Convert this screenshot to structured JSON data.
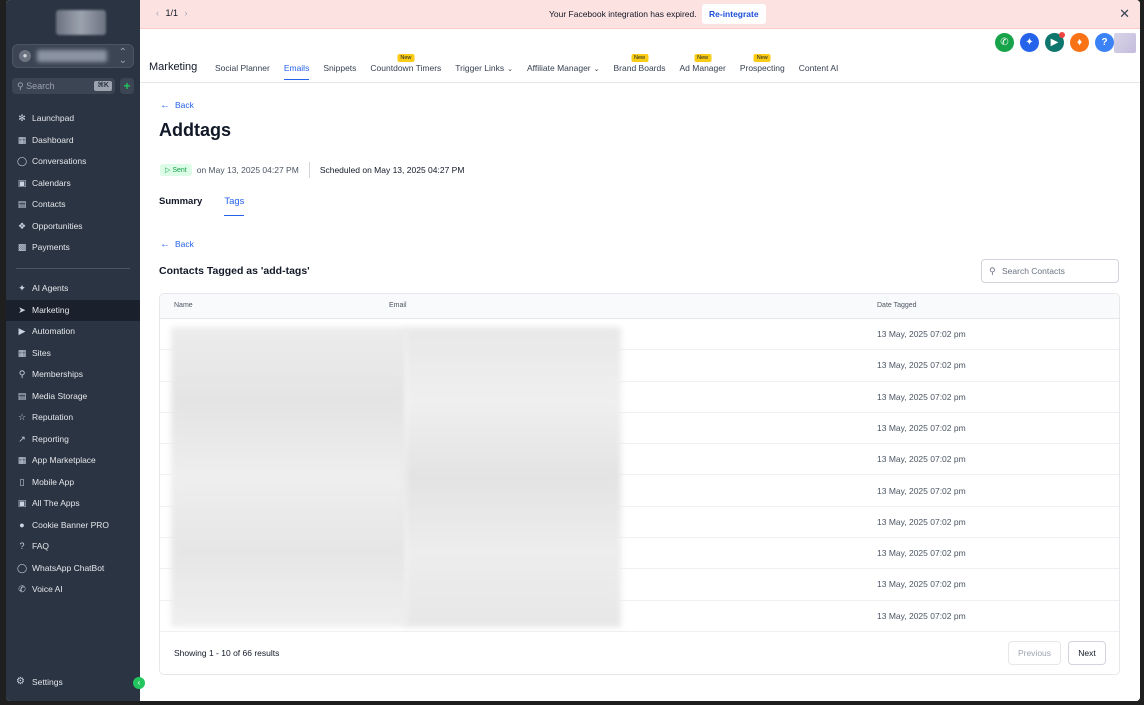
{
  "sidebar": {
    "search_placeholder": "Search",
    "search_shortcut": "⌘K",
    "primary": [
      {
        "label": "Launchpad",
        "icon": "rocket-icon"
      },
      {
        "label": "Dashboard",
        "icon": "grid-icon"
      },
      {
        "label": "Conversations",
        "icon": "chat-icon"
      },
      {
        "label": "Calendars",
        "icon": "calendar-icon"
      },
      {
        "label": "Contacts",
        "icon": "contacts-icon"
      },
      {
        "label": "Opportunities",
        "icon": "opportunities-icon"
      },
      {
        "label": "Payments",
        "icon": "payments-icon"
      }
    ],
    "secondary": [
      {
        "label": "AI Agents",
        "icon": "sparkle-icon"
      },
      {
        "label": "Marketing",
        "icon": "send-icon"
      },
      {
        "label": "Automation",
        "icon": "automation-icon"
      },
      {
        "label": "Sites",
        "icon": "sites-icon"
      },
      {
        "label": "Memberships",
        "icon": "badge-icon"
      },
      {
        "label": "Media Storage",
        "icon": "image-icon"
      },
      {
        "label": "Reputation",
        "icon": "star-icon"
      },
      {
        "label": "Reporting",
        "icon": "trend-icon"
      },
      {
        "label": "App Marketplace",
        "icon": "apps-icon"
      },
      {
        "label": "Mobile App",
        "icon": "mobile-icon"
      },
      {
        "label": "All The Apps",
        "icon": "all-apps-icon"
      },
      {
        "label": "Cookie Banner PRO",
        "icon": "cookie-icon"
      },
      {
        "label": "FAQ",
        "icon": "question-icon"
      },
      {
        "label": "WhatsApp ChatBot",
        "icon": "whatsapp-icon"
      },
      {
        "label": "Voice AI",
        "icon": "phone-icon"
      }
    ],
    "settings_label": "Settings"
  },
  "banner": {
    "pager": "1/1",
    "message": "Your Facebook integration has expired.",
    "action": "Re-integrate"
  },
  "header": {
    "section": "Marketing",
    "tabs": [
      {
        "label": "Social Planner",
        "new": false,
        "dropdown": false
      },
      {
        "label": "Emails",
        "new": false,
        "dropdown": false,
        "active": true
      },
      {
        "label": "Snippets",
        "new": false,
        "dropdown": false
      },
      {
        "label": "Countdown Timers",
        "new": true,
        "dropdown": false
      },
      {
        "label": "Trigger Links",
        "new": false,
        "dropdown": true
      },
      {
        "label": "Affiliate Manager",
        "new": false,
        "dropdown": true
      },
      {
        "label": "Brand Boards",
        "new": true,
        "dropdown": false
      },
      {
        "label": "Ad Manager",
        "new": true,
        "dropdown": false
      },
      {
        "label": "Prospecting",
        "new": true,
        "dropdown": false
      },
      {
        "label": "Content AI",
        "new": false,
        "dropdown": false
      }
    ],
    "new_badge": "New",
    "icon_colors": {
      "phone": "#16a34a",
      "magic": "#2563eb",
      "megaphone": "#0f766e",
      "bell": "#f97316",
      "help": "#3b82f6"
    }
  },
  "page": {
    "back_label": "Back",
    "title": "Addtags",
    "status": "Sent",
    "sent_date": "on May 13, 2025 04:27 PM",
    "scheduled": "Scheduled on May 13, 2025 04:27 PM",
    "sub_tabs": [
      "Summary",
      "Tags"
    ],
    "section_title": "Contacts Tagged as 'add-tags'",
    "search_placeholder": "Search Contacts"
  },
  "table": {
    "columns": [
      "Name",
      "Email",
      "Date Tagged"
    ],
    "rows": [
      "13 May, 2025 07:02 pm",
      "13 May, 2025 07:02 pm",
      "13 May, 2025 07:02 pm",
      "13 May, 2025 07:02 pm",
      "13 May, 2025 07:02 pm",
      "13 May, 2025 07:02 pm",
      "13 May, 2025 07:02 pm",
      "13 May, 2025 07:02 pm",
      "13 May, 2025 07:02 pm",
      "13 May, 2025 07:02 pm"
    ],
    "footer": "Showing 1 - 10 of 66 results",
    "prev_label": "Previous",
    "next_label": "Next"
  }
}
